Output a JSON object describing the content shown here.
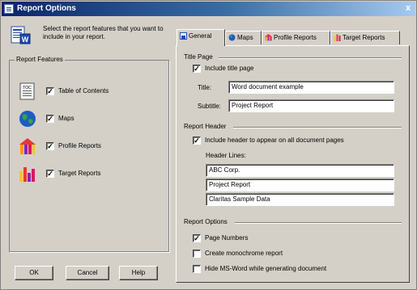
{
  "window": {
    "title": "Report Options",
    "close_glyph": "x"
  },
  "intro": {
    "text": "Select the report features that you want to include in your report."
  },
  "features": {
    "group_title": "Report Features",
    "items": [
      {
        "label": "Table of Contents",
        "checked": true,
        "icon": "table-of-contents-icon",
        "icon_text": "TOC"
      },
      {
        "label": "Maps",
        "checked": true,
        "icon": "globe-icon"
      },
      {
        "label": "Profile Reports",
        "checked": true,
        "icon": "profile-report-icon"
      },
      {
        "label": "Target Reports",
        "checked": true,
        "icon": "target-report-icon"
      }
    ]
  },
  "buttons": {
    "ok": "OK",
    "cancel": "Cancel",
    "help": "Help"
  },
  "tabs": [
    {
      "label": "General",
      "active": true,
      "icon": "document-icon"
    },
    {
      "label": "Maps",
      "active": false,
      "icon": "globe-icon"
    },
    {
      "label": "Profile Reports",
      "active": false,
      "icon": "profile-report-icon"
    },
    {
      "label": "Target Reports",
      "active": false,
      "icon": "target-report-icon"
    }
  ],
  "title_page": {
    "section": "Title Page",
    "include_label": "Include title page",
    "include_checked": true,
    "title_label": "Title:",
    "title_value": "Word document example",
    "subtitle_label": "Subtitle:",
    "subtitle_value": "Project Report"
  },
  "report_header": {
    "section": "Report Header",
    "include_label": "Include header to appear on all document pages",
    "include_checked": true,
    "lines_label": "Header Lines:",
    "lines": [
      "ABC Corp.",
      "Project Report",
      "Claritas Sample Data"
    ]
  },
  "report_options": {
    "section": "Report Options",
    "items": [
      {
        "label": "Page Numbers",
        "checked": true
      },
      {
        "label": "Create monochrome report",
        "checked": false
      },
      {
        "label": "Hide MS-Word while generating document",
        "checked": false
      }
    ]
  },
  "colors": {
    "titlebar_start": "#0a246a",
    "titlebar_end": "#a6caf0",
    "face": "#d4d0c8",
    "profile_icon": "#d81b60",
    "target_icon": "#e53935"
  }
}
